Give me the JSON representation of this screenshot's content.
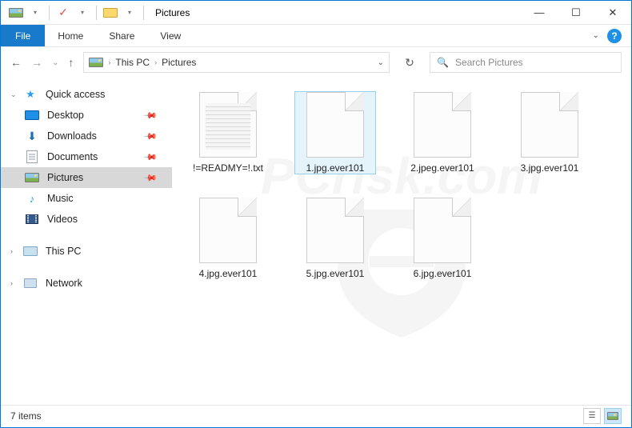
{
  "titlebar": {
    "title": "Pictures",
    "qat_check_icon": "check-icon",
    "qat_pic_icon": "picture-icon",
    "qat_folder_icon": "folder-icon",
    "min_symbol": "—",
    "max_symbol": "☐",
    "close_symbol": "✕"
  },
  "ribbon": {
    "file": "File",
    "tabs": [
      "Home",
      "Share",
      "View"
    ],
    "help_symbol": "?"
  },
  "nav": {
    "back_symbol": "←",
    "forward_symbol": "→",
    "recent_symbol": "⌄",
    "up_symbol": "↑",
    "refresh_symbol": "↻",
    "addr_pic_icon": "picture-icon",
    "breadcrumbs": [
      "This PC",
      "Pictures"
    ],
    "addr_caret_symbol": "⌄",
    "search_icon_symbol": "🔍",
    "search_placeholder": "Search Pictures"
  },
  "sidebar": {
    "quick_access": "Quick access",
    "items": [
      {
        "label": "Desktop",
        "icon": "desktop-icon",
        "pinned": true
      },
      {
        "label": "Downloads",
        "icon": "download-icon",
        "pinned": true
      },
      {
        "label": "Documents",
        "icon": "document-icon",
        "pinned": true
      },
      {
        "label": "Pictures",
        "icon": "picture-icon",
        "pinned": true,
        "selected": true
      },
      {
        "label": "Music",
        "icon": "music-icon",
        "pinned": false
      },
      {
        "label": "Videos",
        "icon": "video-icon",
        "pinned": false
      }
    ],
    "this_pc": "This PC",
    "network": "Network"
  },
  "files": [
    {
      "name": "!=READMY=!.txt",
      "type": "text",
      "selected": false
    },
    {
      "name": "1.jpg.ever101",
      "type": "unknown",
      "selected": true
    },
    {
      "name": "2.jpeg.ever101",
      "type": "unknown",
      "selected": false
    },
    {
      "name": "3.jpg.ever101",
      "type": "unknown",
      "selected": false
    },
    {
      "name": "4.jpg.ever101",
      "type": "unknown",
      "selected": false
    },
    {
      "name": "5.jpg.ever101",
      "type": "unknown",
      "selected": false
    },
    {
      "name": "6.jpg.ever101",
      "type": "unknown",
      "selected": false
    }
  ],
  "status": {
    "count_text": "7 items"
  },
  "watermark": {
    "text_top": "PCrisk.com",
    "shield_icon": "shield-icon"
  }
}
